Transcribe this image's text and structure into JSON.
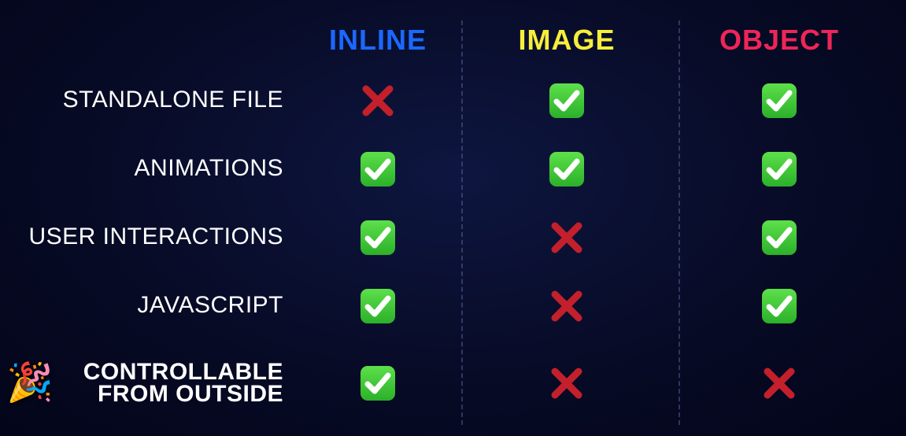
{
  "chart_data": {
    "type": "table",
    "columns": [
      "INLINE",
      "IMAGE",
      "OBJECT"
    ],
    "column_colors": {
      "INLINE": "#1b68ff",
      "IMAGE": "#f7ee3b",
      "OBJECT": "#ee2558"
    },
    "rows": [
      {
        "label": "STANDALONE FILE",
        "values": [
          false,
          true,
          true
        ]
      },
      {
        "label": "ANIMATIONS",
        "values": [
          true,
          true,
          true
        ]
      },
      {
        "label": "USER INTERACTIONS",
        "values": [
          true,
          false,
          true
        ]
      },
      {
        "label": "JAVASCRIPT",
        "values": [
          true,
          false,
          true
        ]
      },
      {
        "label": "CONTROLLABLE\nFROM OUTSIDE",
        "values": [
          true,
          false,
          false
        ],
        "highlight": true,
        "icon": "party-popper"
      }
    ]
  },
  "headers": {
    "c0": "INLINE",
    "c1": "IMAGE",
    "c2": "OBJECT"
  },
  "rows": {
    "r0": "STANDALONE FILE",
    "r1": "ANIMATIONS",
    "r2": "USER INTERACTIONS",
    "r3": "JAVASCRIPT",
    "r4a": "CONTROLLABLE",
    "r4b": "FROM OUTSIDE"
  },
  "party_emoji": "🎉"
}
